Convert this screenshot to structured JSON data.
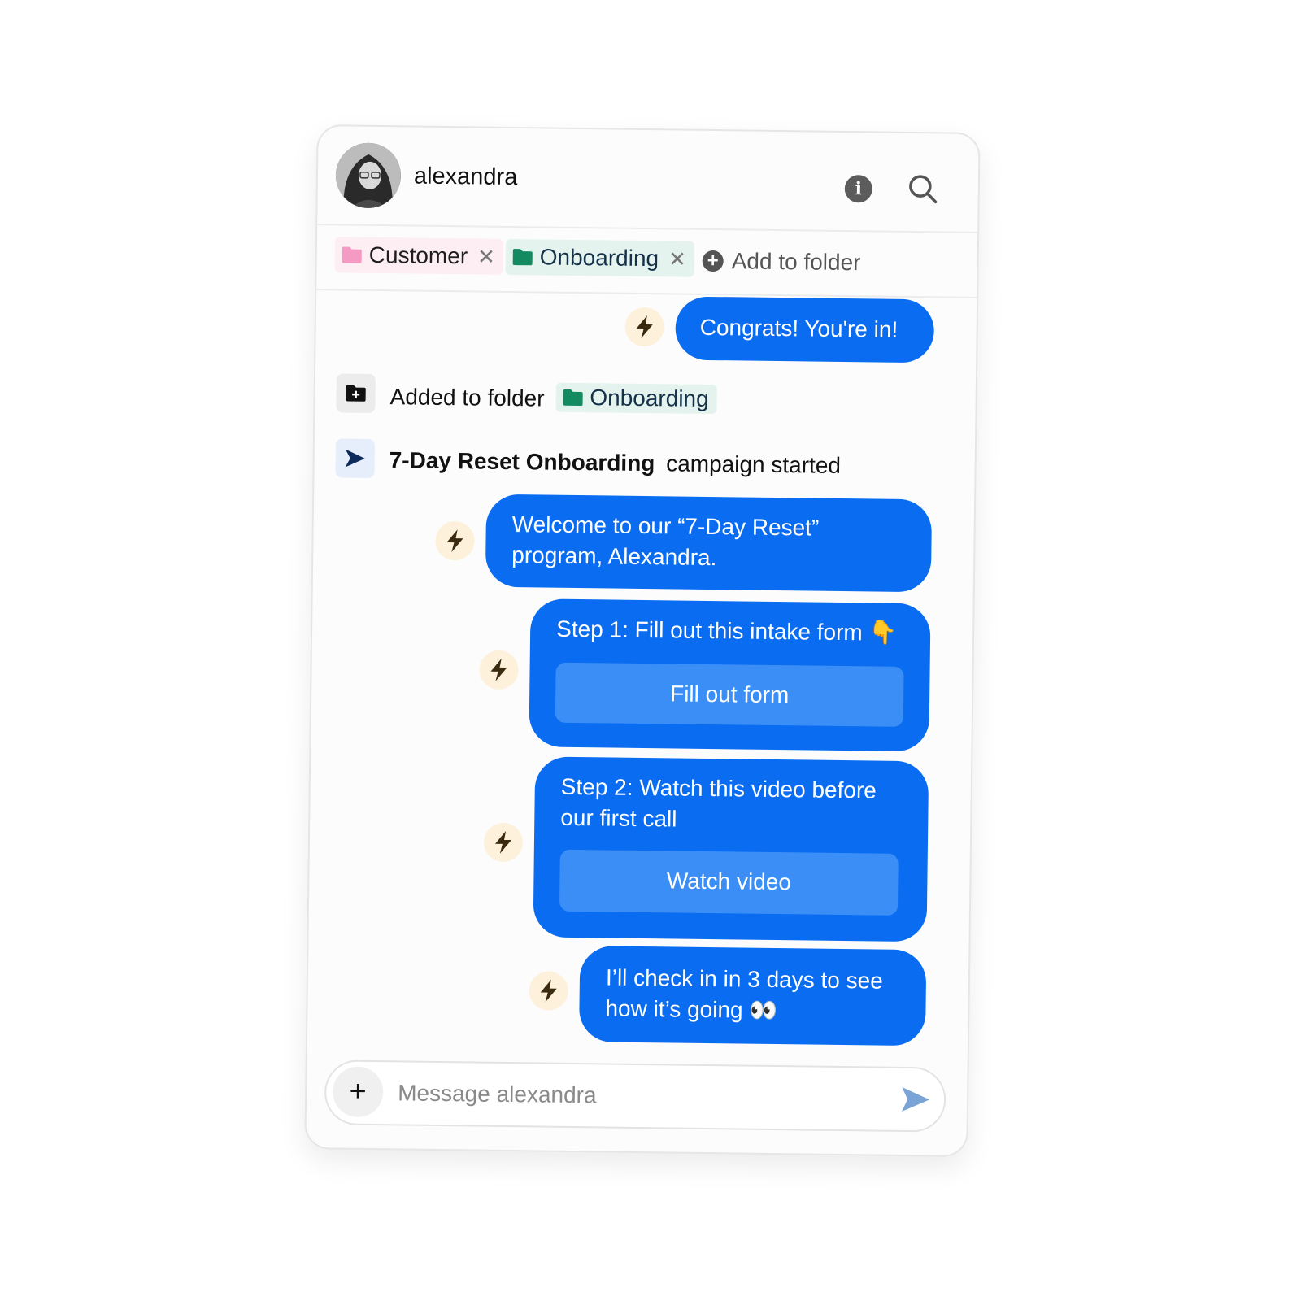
{
  "header": {
    "username": "alexandra",
    "info_icon": "info-icon",
    "search_icon": "search-icon"
  },
  "folders": {
    "tags": [
      {
        "label": "Customer",
        "color": "#f59bc3"
      },
      {
        "label": "Onboarding",
        "color": "#148a60"
      }
    ],
    "remove_glyph": "✕",
    "add_label": "Add to folder"
  },
  "messages": {
    "congrats": "Congrats! You're in!",
    "event_folder": {
      "text": "Added to folder",
      "folder": "Onboarding"
    },
    "event_campaign": {
      "name": "7-Day Reset Onboarding",
      "suffix": "campaign started"
    },
    "welcome": "Welcome to our “7-Day Reset” program, Alexandra.",
    "step1": {
      "text": "Step 1: Fill out this intake form 👇",
      "button": "Fill out form"
    },
    "step2": {
      "text": "Step 2: Watch this video before our first call",
      "button": "Watch video"
    },
    "checkin": "I’ll check in in 3 days to see how it’s going 👀"
  },
  "composer": {
    "add_glyph": "+",
    "placeholder": "Message alexandra"
  },
  "colors": {
    "bubble": "#0a6cf0",
    "inner_button": "#3a8ef6",
    "bolt_bg": "#fdf1dc",
    "send_icon": "#7aa3d6"
  }
}
